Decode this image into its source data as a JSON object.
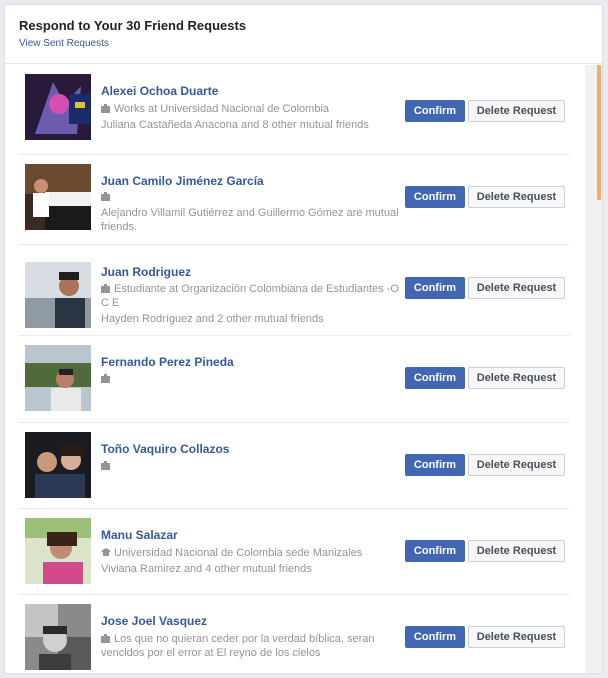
{
  "header": {
    "title": "Respond to Your 30 Friend Requests",
    "sent_link": "View Sent Requests"
  },
  "buttons": {
    "confirm": "Confirm",
    "delete": "Delete Request"
  },
  "requests": [
    {
      "name": "Alexei Ochoa Duarte",
      "icon": "briefcase-icon",
      "line1": "Works at Universidad Nacional de Colombia",
      "line2": "Juliana Castañeda Anacona and 8 other mutual friends"
    },
    {
      "name": "Juan Camilo Jiménez García",
      "icon": "briefcase-icon",
      "line1": "",
      "line2": "Alejandro Villamil Gutiérrez and Guillermo Gómez are mutual friends."
    },
    {
      "name": "Juan Rodriguez",
      "icon": "briefcase-icon",
      "line1": "Estudiante at Organización Colombiana de Estudiantes -O C E",
      "line2": "Hayden Rodríguez and 2 other mutual friends"
    },
    {
      "name": "Fernando Perez Pineda",
      "icon": "briefcase-icon",
      "line1": "",
      "line2": ""
    },
    {
      "name": "Toño Vaquiro Collazos",
      "icon": "briefcase-icon",
      "line1": "",
      "line2": ""
    },
    {
      "name": "Manu Salazar",
      "icon": "graduation-cap-icon",
      "line1": "Universidad Nacional de Colombia sede Manizales",
      "line2": "Viviana Ramirez and 4 other mutual friends"
    },
    {
      "name": "Jose Joel Vasquez",
      "icon": "briefcase-icon",
      "line1": "Los que no quieran ceder por la verdad bíblica, seran vencidos por el error at El reyno de los cielos",
      "line2": ""
    }
  ],
  "colors": {
    "link": "#365899",
    "confirm": "#4267b2",
    "meta": "#90949c",
    "scroll_thumb": "#f4a971"
  }
}
